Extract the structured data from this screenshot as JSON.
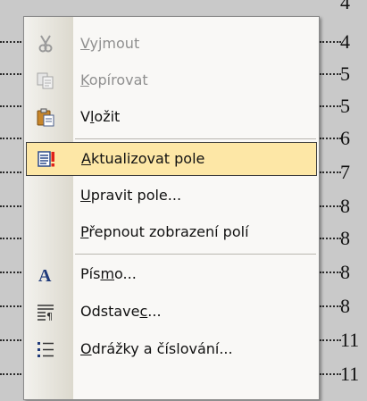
{
  "background_document": {
    "page_numbers": [
      "4",
      "4",
      "5",
      "5",
      "6",
      "7",
      "8",
      "8",
      "8",
      "8",
      "11",
      "11"
    ]
  },
  "context_menu": {
    "items": [
      {
        "pre": "",
        "key": "V",
        "post": "yjmout",
        "enabled": false,
        "icon": "scissors-icon"
      },
      {
        "pre": "",
        "key": "K",
        "post": "opírovat",
        "enabled": false,
        "icon": "copy-icon"
      },
      {
        "pre": "V",
        "key": "l",
        "post": "ožit",
        "enabled": true,
        "icon": "clipboard-paste-icon"
      },
      {
        "pre": "",
        "key": "A",
        "post": "ktualizovat pole",
        "enabled": true,
        "icon": "update-field-icon",
        "highlighted": true
      },
      {
        "pre": "",
        "key": "U",
        "post": "pravit pole...",
        "enabled": true,
        "icon": ""
      },
      {
        "pre": "",
        "key": "P",
        "post": "řepnout zobrazení polí",
        "enabled": true,
        "icon": ""
      },
      {
        "pre": "Pís",
        "key": "m",
        "post": "o...",
        "enabled": true,
        "icon": "font-icon"
      },
      {
        "pre": "Odstave",
        "key": "c",
        "post": "...",
        "enabled": true,
        "icon": "paragraph-icon"
      },
      {
        "pre": "",
        "key": "O",
        "post": "drážky a číslování...",
        "enabled": true,
        "icon": "bullets-numbering-icon"
      }
    ]
  }
}
